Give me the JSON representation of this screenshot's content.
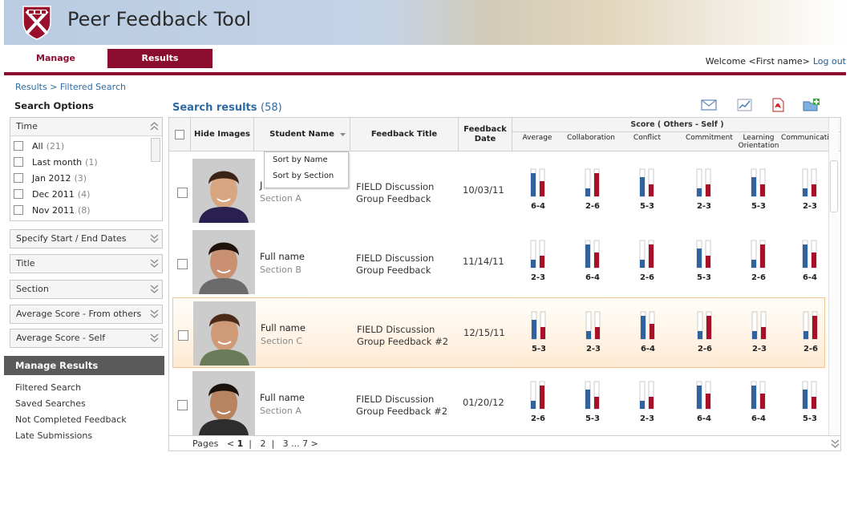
{
  "app": {
    "title": "Peer Feedback Tool"
  },
  "nav": {
    "tabs": [
      {
        "label": "Manage"
      },
      {
        "label": "Results"
      }
    ],
    "welcome": "Welcome <First name>",
    "logout": "Log out"
  },
  "breadcrumb": "Results > Filtered Search",
  "sidebar": {
    "title": "Search Options",
    "time": {
      "label": "Time",
      "items": [
        {
          "label": "All",
          "count": "(21)"
        },
        {
          "label": "Last month",
          "count": "(1)"
        },
        {
          "label": "Jan 2012",
          "count": "(3)"
        },
        {
          "label": "Dec 2011",
          "count": "(4)"
        },
        {
          "label": "Nov 2011",
          "count": "(8)"
        }
      ]
    },
    "filters": [
      "Specify Start / End Dates",
      "Title",
      "Section",
      "Average Score - From others",
      "Average Score - Self"
    ],
    "manage_title": "Manage Results",
    "manage_links": [
      "Filtered Search",
      "Saved Searches",
      "Not Completed Feedback",
      "Late Submissions"
    ]
  },
  "results": {
    "title": "Search results",
    "count": "(58)",
    "columns": {
      "hide_images": "Hide Images",
      "student_name": "Student Name",
      "feedback_title": "Feedback Title",
      "feedback_date_1": "Feedback",
      "feedback_date_2": "Date",
      "score": "Score ( Others - Self )"
    },
    "score_columns": [
      {
        "l1": "Average",
        "l2": ""
      },
      {
        "l1": "Collaboration",
        "l2": ""
      },
      {
        "l1": "Conflict",
        "l2": ""
      },
      {
        "l1": "Commitment",
        "l2": ""
      },
      {
        "l1": "Learning",
        "l2": "Orientation"
      },
      {
        "l1": "Communication",
        "l2": ""
      }
    ],
    "sort_menu": [
      "Sort by Name",
      "Sort by Section"
    ],
    "rows": [
      {
        "name": "J",
        "section": "Section A",
        "title1": "FIELD Discussion",
        "title2": "Group Feedback",
        "date": "10/03/11",
        "scores": [
          "6-4",
          "2-6",
          "5-3",
          "2-3",
          "5-3",
          "2-3"
        ]
      },
      {
        "name": "Full name",
        "section": "Section B",
        "title1": "FIELD Discussion",
        "title2": "Group Feedback",
        "date": "11/14/11",
        "scores": [
          "2-3",
          "6-4",
          "2-6",
          "5-3",
          "2-6",
          "6-4"
        ]
      },
      {
        "name": "Full name",
        "section": "Section C",
        "title1": "FIELD Discussion",
        "title2": "Group Feedback #2",
        "date": "12/15/11",
        "scores": [
          "5-3",
          "2-3",
          "6-4",
          "2-6",
          "2-3",
          "2-6"
        ]
      },
      {
        "name": "Full name",
        "section": "Section A",
        "title1": "FIELD Discussion",
        "title2": "Group Feedback #2",
        "date": "01/20/12",
        "scores": [
          "2-6",
          "5-3",
          "2-3",
          "6-4",
          "6-4",
          "5-3"
        ]
      }
    ],
    "pager": {
      "label": "Pages",
      "prev": "<",
      "current": "1",
      "p2": "2",
      "rest": "3 ... 7",
      "next": ">"
    }
  },
  "colors": {
    "brand": "#8b0d2f",
    "others_bar": "#2f63a0",
    "self_bar": "#a8102a",
    "link": "#2d6aa1"
  }
}
